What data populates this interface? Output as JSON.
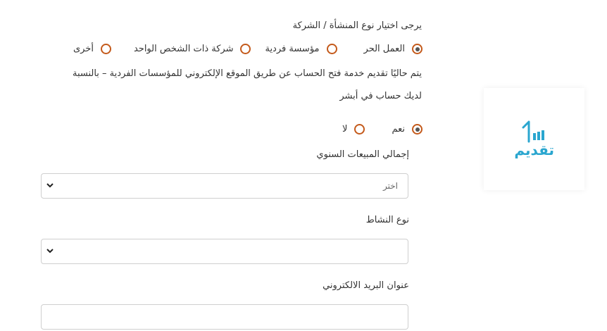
{
  "form": {
    "entity_type_question": "يرجى اختيار نوع المنشأة / الشركة",
    "entity_types": [
      {
        "label": "العمل الحر",
        "selected": true
      },
      {
        "label": "مؤسسة فردية",
        "selected": false
      },
      {
        "label": "شركة ذات الشخص الواحد",
        "selected": false
      },
      {
        "label": "أخرى",
        "selected": false
      }
    ],
    "info_line1": "يتم حاليًا تقديم خدمة فتح الحساب عن طريق الموقع الإلكتروني للمؤسسات الفردية – بالنسبة",
    "info_line2": "لديك حساب في أبشر",
    "yes_no": [
      {
        "label": "نعم",
        "selected": true
      },
      {
        "label": "لا",
        "selected": false
      }
    ],
    "annual_sales_label": "إجمالي المبيعات السنوي",
    "annual_sales_placeholder": "اختر",
    "activity_type_label": "نوع النشاط",
    "activity_type_value": "",
    "email_label": "عنوان البريد الالكتروني",
    "email_value": ""
  },
  "logo": {
    "text": "تقديم",
    "color": "#2aa6cf"
  },
  "accent_color": "#c45a1b"
}
